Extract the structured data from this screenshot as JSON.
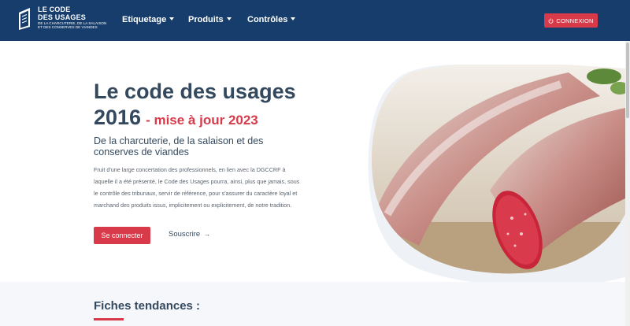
{
  "header": {
    "logo": {
      "line1": "LE CODE",
      "line2": "DES USAGES",
      "sub1": "DE LA CHARCUTERIE, DE LA SALAISON",
      "sub2": "ET DES CONSERVES DE VIANDES",
      "icon": "book-logo-icon"
    },
    "nav": [
      {
        "label": "Etiquetage",
        "icon": "caret-down-icon"
      },
      {
        "label": "Produits",
        "icon": "caret-down-icon"
      },
      {
        "label": "Contrôles",
        "icon": "caret-down-icon"
      }
    ],
    "connexion_label": "CONNEXION",
    "connexion_icon": "power-icon"
  },
  "hero": {
    "title": "Le code des usages",
    "year": "2016",
    "update": "- mise à jour 2023",
    "subtitle": "De la charcuterie, de la salaison et des conserves de viandes",
    "body": "Fruit d'une large concertation des professionnels, en lien avec la DGCCRF à laquelle il a été présenté, le Code des Usages pourra, ainsi, plus que jamais, sous le contrôle des tribunaux, servir de référence, pour s'assurer du caractère loyal et marchand des produits issus, implicitement ou explicitement, de notre tradition.",
    "primary_button": "Se connecter",
    "secondary_link": "Souscrire",
    "secondary_icon": "arrow-right-icon",
    "image": "saucisson-image"
  },
  "section": {
    "title": "Fiches tendances :"
  },
  "colors": {
    "header_bg": "#163d6b",
    "accent": "#d83a4a",
    "text_dark": "#34495e",
    "section_bg": "#f5f7fb"
  }
}
